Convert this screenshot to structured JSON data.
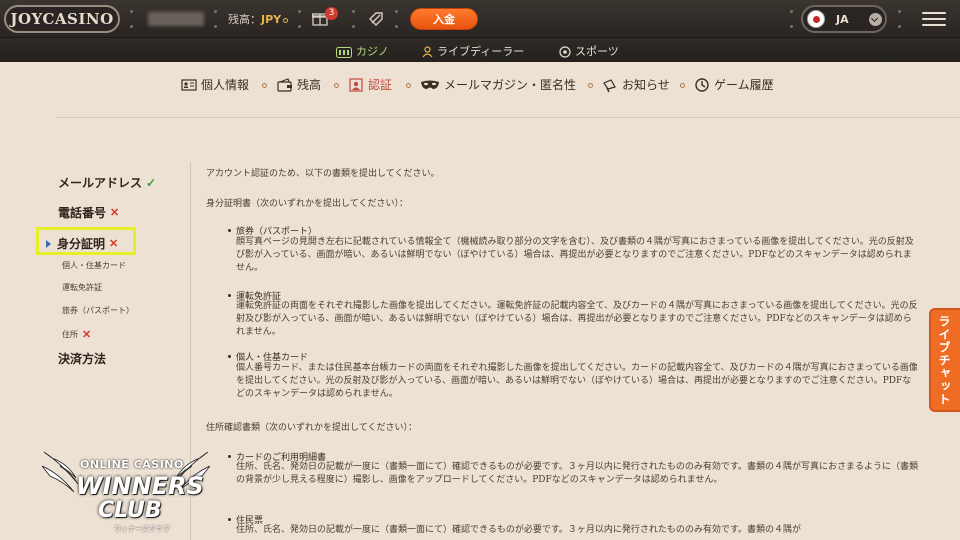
{
  "header": {
    "logo": "JOYCASINO",
    "balance_label": "残高：",
    "balance_currency": "JPY",
    "gift_count": "3",
    "deposit_label": "入金",
    "language": "JA"
  },
  "subnav": [
    {
      "label": "カジノ",
      "icon": "casino-icon",
      "active": true
    },
    {
      "label": "ライブディーラー",
      "icon": "live-dealer-icon",
      "active": false
    },
    {
      "label": "スポーツ",
      "icon": "sports-icon",
      "active": false
    }
  ],
  "tabs": [
    {
      "label": "個人情報",
      "icon": "id-card-icon"
    },
    {
      "label": "残高",
      "icon": "wallet-icon"
    },
    {
      "label": "認証",
      "icon": "verification-icon",
      "active": true
    },
    {
      "label": "メールマガジン・匿名性",
      "icon": "mask-icon"
    },
    {
      "label": "お知らせ",
      "icon": "megaphone-icon"
    },
    {
      "label": "ゲーム履歴",
      "icon": "history-icon"
    }
  ],
  "sidebar": {
    "email": "メールアドレス",
    "phone": "電話番号",
    "identity": "身分証明",
    "identity_items": [
      "個人・住基カード",
      "運転免許証",
      "旅券（パスポート）",
      "住所"
    ],
    "payment": "決済方法"
  },
  "content": {
    "intro": "アカウント認証のため、以下の書類を提出してください。",
    "id_section": "身分証明書（次のいずれかを提出してください）：",
    "passport_title": "旅券（パスポート）",
    "passport_desc": "顔写真ページの見開き左右に記載されている情報全て（機械読み取り部分の文字を含む）、及び書類の４隅が写真におさまっている画像を提出してください。光の反射及び影が入っている、画面が暗い、あるいは鮮明でない（ぼやけている）場合は、再提出が必要となりますのでご注意ください。PDFなどのスキャンデータは認められません。",
    "license_title": "運転免許証",
    "license_desc": "運転免許証の両面をそれぞれ撮影した画像を提出してください。運転免許証の記載内容全て、及びカードの４隅が写真におさまっている画像を提出してください。光の反射及び影が入っている、画面が暗い、あるいは鮮明でない（ぼやけている）場合は、再提出が必要となりますのでご注意ください。PDFなどのスキャンデータは認められません。",
    "card_title": "個人・住基カード",
    "card_desc": "個人番号カード、または住民基本台帳カードの両面をそれぞれ撮影した画像を提出してください。カードの記載内容全て、及びカードの４隅が写真におさまっている画像を提出してください。光の反射及び影が入っている、画面が暗い、あるいは鮮明でない（ぼやけている）場合は、再提出が必要となりますのでご注意ください。PDFなどのスキャンデータは認められません。",
    "address_section": "住所確認書類（次のいずれかを提出してください）：",
    "credit_title": "カードのご利用明細書",
    "credit_desc": "住所、氏名、発効日の記載が一度に（書類一面にて）確認できるものが必要です。３ヶ月以内に発行されたもののみ有効です。書類の４隅が写真におさまるように（書類の背景が少し見える程度に）撮影し、画像をアップロードしてください。PDFなどのスキャンデータは認められません。",
    "resident_title": "住民票",
    "resident_desc": "住所、氏名、発効日の記載が一度に（書類一面にて）確認できるものが必要です。３ヶ月以内に発行されたもののみ有効です。書類の４隅が"
  },
  "livechat_label": "ライブチャット",
  "watermark": {
    "line1": "ONLINE CASINO",
    "line2": "WINNERS",
    "line3": "CLUB",
    "line4": "ウィナーズクラブ"
  },
  "colors": {
    "accent": "#e8530f",
    "active_tab": "#c14a3e",
    "active_nav": "#b6d67a",
    "highlight": "#e6f02a",
    "ok": "#3e9a3e",
    "ng": "#d33a2c"
  }
}
